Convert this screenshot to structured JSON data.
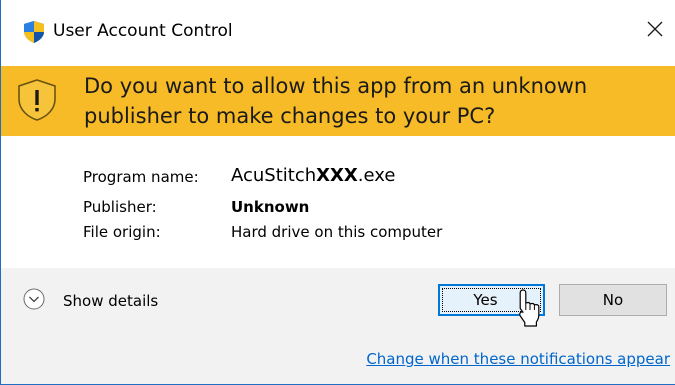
{
  "window": {
    "title": "User Account Control"
  },
  "banner": {
    "question_line1": "Do you want to allow this app from an unknown",
    "question_line2": "publisher to make changes to your PC?"
  },
  "info": {
    "program_label": "Program name:",
    "program_value_prefix": "AcuStitch",
    "program_value_bold": "XXX",
    "program_value_suffix": ".exe",
    "publisher_label": "Publisher:",
    "publisher_value": "Unknown",
    "origin_label": "File origin:",
    "origin_value": "Hard drive on this computer"
  },
  "footer": {
    "show_details_label": "Show details",
    "yes_label": "Yes",
    "no_label": "No",
    "notifications_link": "Change when these notifications appear"
  },
  "icons": {
    "title": "uac-shield-icon",
    "close": "close-icon",
    "warning": "warning-shield-icon",
    "details": "chevron-down-circle-icon",
    "cursor": "mouse-pointer-icon"
  },
  "colors": {
    "banner": "#f6bb26",
    "footer": "#f2f2f2",
    "accent": "#0078d7",
    "link": "#0066cc"
  }
}
